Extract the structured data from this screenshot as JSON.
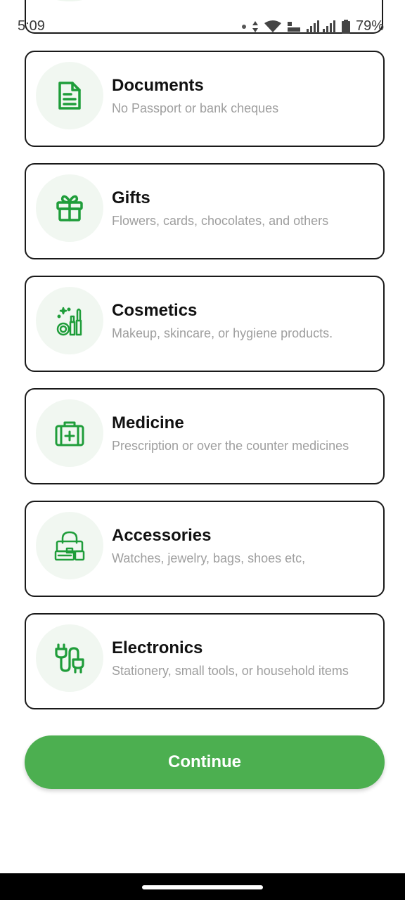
{
  "status_bar": {
    "time": "5:09",
    "battery": "79%"
  },
  "categories": [
    {
      "title": "Documents",
      "subtitle": "No Passport or bank cheques",
      "icon": "document-icon"
    },
    {
      "title": "Gifts",
      "subtitle": "Flowers, cards, chocolates, and others",
      "icon": "gift-icon"
    },
    {
      "title": "Cosmetics",
      "subtitle": "Makeup, skincare, or hygiene products.",
      "icon": "cosmetics-icon"
    },
    {
      "title": "Medicine",
      "subtitle": "Prescription or over the counter medicines",
      "icon": "medical-kit-icon"
    },
    {
      "title": "Accessories",
      "subtitle": "Watches, jewelry, bags, shoes etc,",
      "icon": "shopping-bag-icon"
    },
    {
      "title": "Electronics",
      "subtitle": "Stationery, small tools, or household items",
      "icon": "plug-icon"
    }
  ],
  "continue_button": {
    "label": "Continue"
  },
  "colors": {
    "accent": "#4caf50",
    "icon_green": "#1f9d3a",
    "icon_bg": "#f1f7f1"
  }
}
